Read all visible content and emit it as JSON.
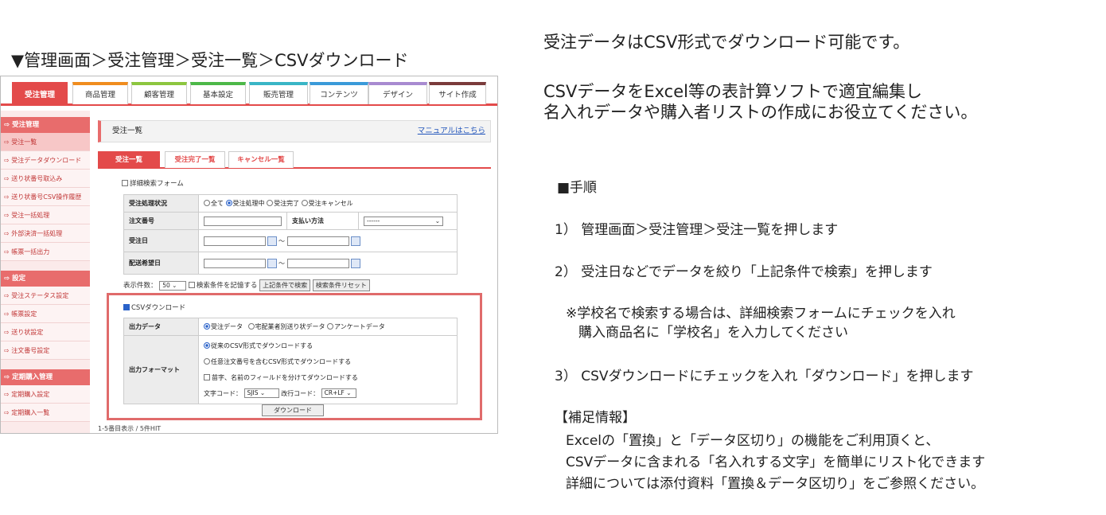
{
  "caption": "▼管理画面＞受注管理＞受注一覧＞CSVダウンロード",
  "main_tabs": [
    {
      "label": "受注管理",
      "color": "#e34a4a"
    },
    {
      "label": "商品管理",
      "color": "#f08c1e"
    },
    {
      "label": "顧客管理",
      "color": "#8cc63f"
    },
    {
      "label": "基本設定",
      "color": "#4cb848"
    },
    {
      "label": "販売管理",
      "color": "#39b5c6"
    },
    {
      "label": "コンテンツ",
      "color": "#3a9ad9"
    },
    {
      "label": "デザイン",
      "color": "#a88ad0"
    },
    {
      "label": "サイト作成",
      "color": "#7a3b3b"
    }
  ],
  "sidebar": {
    "sections": [
      {
        "title": "受注管理",
        "items": [
          "受注一覧",
          "受注データダウンロード",
          "送り状番号取込み",
          "送り状番号CSV操作履歴",
          "受注一括処理",
          "外部決済一括処理",
          "帳票一括出力"
        ]
      },
      {
        "title": "設定",
        "items": [
          "受注ステータス設定",
          "帳票設定",
          "送り状設定",
          "注文番号設定"
        ]
      },
      {
        "title": "定期購入管理",
        "items": [
          "定期購入設定",
          "定期購入一覧"
        ]
      }
    ]
  },
  "page": {
    "title": "受注一覧",
    "manual_link": "マニュアルはこちら",
    "subtabs": [
      "受注一覧",
      "受注完了一覧",
      "キャンセル一覧"
    ]
  },
  "search": {
    "detail_form_label": "詳細検索フォーム",
    "status_label": "受注処理状況",
    "status_options": [
      "全て",
      "受注処理中",
      "受注完了",
      "受注キャンセル"
    ],
    "order_no_label": "注文番号",
    "payment_label": "支払い方法",
    "payment_value": "------",
    "order_date_label": "受注日",
    "delivery_date_label": "配送希望日",
    "range_sep": "～",
    "count_label": "表示件数：",
    "count_value": "50",
    "remember_label": "検索条件を記憶する",
    "search_button": "上記条件で検索",
    "reset_button": "検索条件リセット"
  },
  "csv": {
    "checkbox_label": "CSVダウンロード",
    "output_data_label": "出力データ",
    "output_data_options": [
      "受注データ",
      "宅配業者別送り状データ",
      "アンケートデータ"
    ],
    "format_label": "出力フォーマット",
    "format_options": [
      "従来のCSV形式でダウンロードする",
      "任意注文番号を含むCSV形式でダウンロードする"
    ],
    "split_name_label": "苗字、名前のフィールドを分けてダウンロードする",
    "charcode_label": "文字コード：",
    "charcode_value": "SJIS",
    "newline_label": "改行コード：",
    "newline_value": "CR+LF",
    "download_button": "ダウンロード",
    "hit_text": "1-5番目表示 / 5件HIT"
  },
  "right": {
    "line1": "受注データはCSV形式でダウンロード可能です。",
    "line2": "CSVデータをExcel等の表計算ソフトで適宜編集し",
    "line3": "名入れデータや購入者リストの作成にお役立てください。",
    "procedure_title": "■手順",
    "step1": "1） 管理画面＞受注管理＞受注一覧を押します",
    "step2": "2） 受注日などでデータを絞り「上記条件で検索」を押します",
    "note1": "※学校名で検索する場合は、詳細検索フォームにチェックを入れ",
    "note2": "購入商品名に「学校名」を入力してください",
    "step3": "3） CSVダウンロードにチェックを入れ「ダウンロード」を押します",
    "supp_title": "【補足情報】",
    "supp1": "Excelの「置換」と「データ区切り」の機能をご利用頂くと、",
    "supp2": "CSVデータに含まれる「名入れする文字」を簡単にリスト化できます",
    "supp3": "詳細については添付資料「置換＆データ区切り」をご参照ください。"
  }
}
